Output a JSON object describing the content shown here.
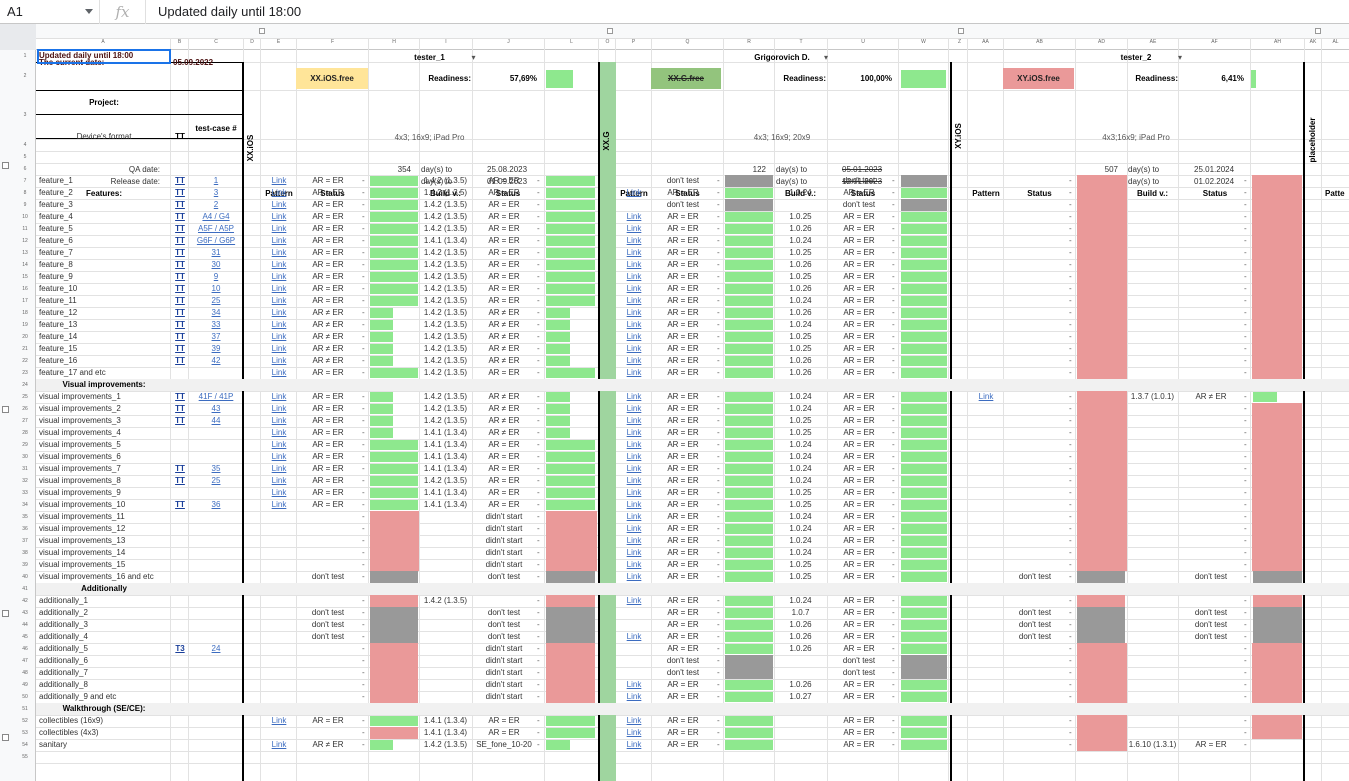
{
  "formula_bar": {
    "cell": "A1",
    "fx": "fx",
    "value": "Updated daily until 18:00"
  },
  "col_headers": [
    "A",
    "B",
    "C",
    "D",
    "E",
    "F",
    "H",
    "I",
    "J",
    "L",
    "O",
    "P",
    "Q",
    "R",
    "T",
    "U",
    "W",
    "Z",
    "AA",
    "AB",
    "AD",
    "AE",
    "AF",
    "AH",
    "AK",
    "AL"
  ],
  "header": {
    "updated": "Updated daily until 18:00",
    "current_date_label": "The current date:",
    "current_date": "05.09.2022",
    "project_label": "Project:",
    "device_label": "Device's format",
    "tt_label": "TT",
    "testcase_label": "test-case #",
    "qa_label": "QA date:",
    "release_label": "Release date:",
    "features_label": "Features:",
    "visual_label": "Visual improvements:",
    "additionally_label": "Additionally",
    "walkthrough_label": "Walkthrough (SE/CE):"
  },
  "vertical_labels": {
    "xx_ios": "XX.iOS",
    "xx_g": "XX.G",
    "xy_ios": "XY.iOS",
    "placeholder": "placeholder"
  },
  "testers": [
    {
      "name": "tester_1",
      "project": "XX.iOS.free",
      "readiness_label": "Readiness:",
      "readiness": "57,69%",
      "formats": "4x3; 16x9; iPad Pro",
      "qa_days": "354",
      "qa_to": "day(s) to",
      "qa_date": "25.08.2023",
      "rel_days": "361",
      "rel_to": "day(s) to",
      "rel_date": "01.09.2023",
      "project_color": "#ffe599"
    },
    {
      "name": "Grigorovich D.",
      "project": "XX.G.free",
      "readiness_label": "Readiness:",
      "readiness": "100,00%",
      "formats": "4x3; 16x9; 20x9",
      "qa_days": "122",
      "qa_to": "day(s) to",
      "qa_date": "05.01.2023",
      "rel_days": "129",
      "rel_to": "day(s) to",
      "rel_date": "12.01.2023",
      "project_color": "#93c47d"
    },
    {
      "name": "tester_2",
      "project": "XY.iOS.free",
      "readiness_label": "Readiness:",
      "readiness": "6,41%",
      "formats": "4x3;16x9; iPad Pro",
      "qa_days": "507",
      "qa_to": "day(s) to",
      "qa_date": "25.01.2024",
      "rel_days": "514",
      "rel_to": "day(s) to",
      "rel_date": "01.02.2024",
      "project_color": "#ea9999"
    }
  ],
  "sub_headers": {
    "pattern": "Pattern",
    "status": "Status",
    "readiness": "Readiness",
    "build": "Build v.:",
    "status2": "Status",
    "readiness2": "Readiness",
    "patte": "Patte"
  },
  "link_text": "Link",
  "rows": [
    {
      "n": "7",
      "name": "feature_1",
      "tt": "TT",
      "tc": "1",
      "t1": [
        "Link",
        "AR = ER",
        "G",
        "1.4.2 (1.3.5)",
        "AR = ER",
        "G"
      ],
      "t2": [
        "",
        "don't test",
        "Y",
        "",
        "don't test",
        "Y"
      ]
    },
    {
      "n": "8",
      "name": "feature_2",
      "tt": "TT",
      "tc": "3",
      "t1": [
        "Link",
        "AR = ER",
        "G",
        "1.4.2 (1.3.5)",
        "AR = ER",
        "G"
      ],
      "t2": [
        "Link",
        "AR = ER",
        "G",
        "1.0.24",
        "AR = ER",
        "G"
      ]
    },
    {
      "n": "9",
      "name": "feature_3",
      "tt": "TT",
      "tc": "2",
      "t1": [
        "Link",
        "AR = ER",
        "G",
        "1.4.2 (1.3.5)",
        "AR = ER",
        "G"
      ],
      "t2": [
        "",
        "don't test",
        "Y",
        "",
        "don't test",
        "Y"
      ]
    },
    {
      "n": "10",
      "name": "feature_4",
      "tt": "TT",
      "tc": "A4 / G4",
      "t1": [
        "Link",
        "AR = ER",
        "G",
        "1.4.2 (1.3.5)",
        "AR = ER",
        "G"
      ],
      "t2": [
        "Link",
        "AR = ER",
        "G",
        "1.0.25",
        "AR = ER",
        "G"
      ]
    },
    {
      "n": "11",
      "name": "feature_5",
      "tt": "TT",
      "tc": "A5F / A5P",
      "t1": [
        "Link",
        "AR = ER",
        "G",
        "1.4.2 (1.3.5)",
        "AR = ER",
        "G"
      ],
      "t2": [
        "Link",
        "AR = ER",
        "G",
        "1.0.26",
        "AR = ER",
        "G"
      ]
    },
    {
      "n": "12",
      "name": "feature_6",
      "tt": "TT",
      "tc": "G6F / G6P",
      "t1": [
        "Link",
        "AR = ER",
        "G",
        "1.4.1 (1.3.4)",
        "AR = ER",
        "G"
      ],
      "t2": [
        "Link",
        "AR = ER",
        "G",
        "1.0.24",
        "AR = ER",
        "G"
      ]
    },
    {
      "n": "13",
      "name": "feature_7",
      "tt": "TT",
      "tc": "31",
      "t1": [
        "Link",
        "AR = ER",
        "G",
        "1.4.2 (1.3.5)",
        "AR = ER",
        "G"
      ],
      "t2": [
        "Link",
        "AR = ER",
        "G",
        "1.0.25",
        "AR = ER",
        "G"
      ]
    },
    {
      "n": "14",
      "name": "feature_8",
      "tt": "TT",
      "tc": "30",
      "t1": [
        "Link",
        "AR = ER",
        "G",
        "1.4.2 (1.3.5)",
        "AR = ER",
        "G"
      ],
      "t2": [
        "Link",
        "AR = ER",
        "G",
        "1.0.26",
        "AR = ER",
        "G"
      ]
    },
    {
      "n": "15",
      "name": "feature_9",
      "tt": "TT",
      "tc": "9",
      "t1": [
        "Link",
        "AR = ER",
        "G",
        "1.4.2 (1.3.5)",
        "AR = ER",
        "G"
      ],
      "t2": [
        "Link",
        "AR = ER",
        "G",
        "1.0.25",
        "AR = ER",
        "G"
      ]
    },
    {
      "n": "16",
      "name": "feature_10",
      "tt": "TT",
      "tc": "10",
      "t1": [
        "Link",
        "AR = ER",
        "G",
        "1.4.2 (1.3.5)",
        "AR = ER",
        "G"
      ],
      "t2": [
        "Link",
        "AR = ER",
        "G",
        "1.0.26",
        "AR = ER",
        "G"
      ]
    },
    {
      "n": "17",
      "name": "feature_11",
      "tt": "TT",
      "tc": "25",
      "t1": [
        "Link",
        "AR = ER",
        "G",
        "1.4.2 (1.3.5)",
        "AR = ER",
        "G"
      ],
      "t2": [
        "Link",
        "AR = ER",
        "G",
        "1.0.24",
        "AR = ER",
        "G"
      ]
    },
    {
      "n": "18",
      "name": "feature_12",
      "tt": "TT",
      "tc": "34",
      "t1": [
        "Link",
        "AR ≠ ER",
        "S",
        "1.4.2 (1.3.5)",
        "AR ≠ ER",
        "S"
      ],
      "t2": [
        "Link",
        "AR = ER",
        "G",
        "1.0.26",
        "AR = ER",
        "G"
      ]
    },
    {
      "n": "19",
      "name": "feature_13",
      "tt": "TT",
      "tc": "33",
      "t1": [
        "Link",
        "AR ≠ ER",
        "S",
        "1.4.2 (1.3.5)",
        "AR ≠ ER",
        "S"
      ],
      "t2": [
        "Link",
        "AR = ER",
        "G",
        "1.0.24",
        "AR = ER",
        "G"
      ]
    },
    {
      "n": "20",
      "name": "feature_14",
      "tt": "TT",
      "tc": "37",
      "t1": [
        "Link",
        "AR ≠ ER",
        "S",
        "1.4.2 (1.3.5)",
        "AR ≠ ER",
        "S"
      ],
      "t2": [
        "Link",
        "AR = ER",
        "G",
        "1.0.25",
        "AR = ER",
        "G"
      ]
    },
    {
      "n": "21",
      "name": "feature_15",
      "tt": "TT",
      "tc": "39",
      "t1": [
        "Link",
        "AR ≠ ER",
        "S",
        "1.4.2 (1.3.5)",
        "AR ≠ ER",
        "S"
      ],
      "t2": [
        "Link",
        "AR = ER",
        "G",
        "1.0.25",
        "AR = ER",
        "G"
      ]
    },
    {
      "n": "22",
      "name": "feature_16",
      "tt": "TT",
      "tc": "42",
      "t1": [
        "Link",
        "AR ≠ ER",
        "S",
        "1.4.2 (1.3.5)",
        "AR ≠ ER",
        "S"
      ],
      "t2": [
        "Link",
        "AR = ER",
        "G",
        "1.0.26",
        "AR = ER",
        "G"
      ]
    },
    {
      "n": "23",
      "name": "feature_17 and etc",
      "tt": "",
      "tc": "",
      "t1": [
        "Link",
        "AR = ER",
        "G",
        "1.4.2 (1.3.5)",
        "AR = ER",
        "G"
      ],
      "t2": [
        "Link",
        "AR = ER",
        "G",
        "1.0.26",
        "AR = ER",
        "G"
      ]
    },
    {
      "n": "24",
      "sec": "visual"
    },
    {
      "n": "25",
      "name": "visual improvements_1",
      "tt": "TT",
      "tc": "41F / 41P",
      "t1": [
        "Link",
        "AR = ER",
        "S",
        "1.4.2 (1.3.5)",
        "AR ≠ ER",
        "S"
      ],
      "t2": [
        "Link",
        "AR = ER",
        "G",
        "1.0.24",
        "AR = ER",
        "G"
      ],
      "t3": [
        "Link",
        "",
        "",
        "1.3.7 (1.0.1)",
        "AR ≠ ER",
        "S"
      ]
    },
    {
      "n": "26",
      "name": "visual improvements_2",
      "tt": "TT",
      "tc": "43",
      "t1": [
        "Link",
        "AR = ER",
        "S",
        "1.4.2 (1.3.5)",
        "AR ≠ ER",
        "S"
      ],
      "t2": [
        "Link",
        "AR = ER",
        "G",
        "1.0.24",
        "AR = ER",
        "G"
      ]
    },
    {
      "n": "27",
      "name": "visual improvements_3",
      "tt": "TT",
      "tc": "44",
      "t1": [
        "Link",
        "AR = ER",
        "S",
        "1.4.2 (1.3.5)",
        "AR ≠ ER",
        "S"
      ],
      "t2": [
        "Link",
        "AR = ER",
        "G",
        "1.0.25",
        "AR = ER",
        "G"
      ]
    },
    {
      "n": "28",
      "name": "visual improvements_4",
      "tt": "",
      "tc": "",
      "t1": [
        "Link",
        "AR = ER",
        "S",
        "1.4.1 (1.3.4)",
        "AR ≠ ER",
        "S"
      ],
      "t2": [
        "Link",
        "AR = ER",
        "G",
        "1.0.25",
        "AR = ER",
        "G"
      ]
    },
    {
      "n": "29",
      "name": "visual improvements_5",
      "tt": "",
      "tc": "",
      "t1": [
        "Link",
        "AR = ER",
        "G",
        "1.4.1 (1.3.4)",
        "AR = ER",
        "G"
      ],
      "t2": [
        "Link",
        "AR = ER",
        "G",
        "1.0.24",
        "AR = ER",
        "G"
      ]
    },
    {
      "n": "30",
      "name": "visual improvements_6",
      "tt": "",
      "tc": "",
      "t1": [
        "Link",
        "AR = ER",
        "G",
        "1.4.1 (1.3.4)",
        "AR = ER",
        "G"
      ],
      "t2": [
        "Link",
        "AR = ER",
        "G",
        "1.0.24",
        "AR = ER",
        "G"
      ]
    },
    {
      "n": "31",
      "name": "visual improvements_7",
      "tt": "TT",
      "tc": "35",
      "t1": [
        "Link",
        "AR = ER",
        "G",
        "1.4.1 (1.3.4)",
        "AR = ER",
        "G"
      ],
      "t2": [
        "Link",
        "AR = ER",
        "G",
        "1.0.24",
        "AR = ER",
        "G"
      ]
    },
    {
      "n": "32",
      "name": "visual improvements_8",
      "tt": "TT",
      "tc": "25",
      "t1": [
        "Link",
        "AR = ER",
        "G",
        "1.4.2 (1.3.5)",
        "AR = ER",
        "G"
      ],
      "t2": [
        "Link",
        "AR = ER",
        "G",
        "1.0.24",
        "AR = ER",
        "G"
      ]
    },
    {
      "n": "33",
      "name": "visual improvements_9",
      "tt": "",
      "tc": "",
      "t1": [
        "Link",
        "AR = ER",
        "G",
        "1.4.1 (1.3.4)",
        "AR = ER",
        "G"
      ],
      "t2": [
        "Link",
        "AR = ER",
        "G",
        "1.0.25",
        "AR = ER",
        "G"
      ]
    },
    {
      "n": "34",
      "name": "visual improvements_10",
      "tt": "TT",
      "tc": "36",
      "t1": [
        "Link",
        "AR = ER",
        "G",
        "1.4.1 (1.3.4)",
        "AR = ER",
        "G"
      ],
      "t2": [
        "Link",
        "AR = ER",
        "G",
        "1.0.25",
        "AR = ER",
        "G"
      ]
    },
    {
      "n": "35",
      "name": "visual improvements_11",
      "tt": "",
      "tc": "",
      "t1": [
        "",
        "",
        "R",
        "",
        "didn't start",
        "R"
      ],
      "t2": [
        "Link",
        "AR = ER",
        "G",
        "1.0.24",
        "AR = ER",
        "G"
      ]
    },
    {
      "n": "36",
      "name": "visual improvements_12",
      "tt": "",
      "tc": "",
      "t1": [
        "",
        "",
        "R",
        "",
        "didn't start",
        "R"
      ],
      "t2": [
        "Link",
        "AR = ER",
        "G",
        "1.0.24",
        "AR = ER",
        "G"
      ]
    },
    {
      "n": "37",
      "name": "visual improvements_13",
      "tt": "",
      "tc": "",
      "t1": [
        "",
        "",
        "R",
        "",
        "didn't start",
        "R"
      ],
      "t2": [
        "Link",
        "AR = ER",
        "G",
        "1.0.24",
        "AR = ER",
        "G"
      ]
    },
    {
      "n": "38",
      "name": "visual improvements_14",
      "tt": "",
      "tc": "",
      "t1": [
        "",
        "",
        "R",
        "",
        "didn't start",
        "R"
      ],
      "t2": [
        "Link",
        "AR = ER",
        "G",
        "1.0.24",
        "AR = ER",
        "G"
      ]
    },
    {
      "n": "39",
      "name": "visual improvements_15",
      "tt": "",
      "tc": "",
      "t1": [
        "",
        "",
        "R",
        "",
        "didn't start",
        "R"
      ],
      "t2": [
        "Link",
        "AR = ER",
        "G",
        "1.0.25",
        "AR = ER",
        "G"
      ]
    },
    {
      "n": "40",
      "name": "visual improvements_16 and etc",
      "tt": "",
      "tc": "",
      "t1": [
        "",
        "don't test",
        "Y",
        "",
        "don't test",
        "Y"
      ],
      "t2": [
        "Link",
        "AR = ER",
        "G",
        "1.0.25",
        "AR = ER",
        "G"
      ],
      "t3": [
        "",
        "don't test",
        "Y",
        "",
        "don't test",
        "Y"
      ]
    },
    {
      "n": "41",
      "sec": "additionally"
    },
    {
      "n": "42",
      "name": "additionally_1",
      "tt": "",
      "tc": "",
      "t1": [
        "",
        "",
        "R",
        "1.4.2 (1.3.5)",
        "",
        "R"
      ],
      "t2": [
        "Link",
        "AR = ER",
        "G",
        "1.0.24",
        "AR = ER",
        "G"
      ],
      "t3": [
        "",
        "",
        "R",
        "",
        "",
        "R"
      ]
    },
    {
      "n": "43",
      "name": "additionally_2",
      "tt": "",
      "tc": "",
      "t1": [
        "",
        "don't test",
        "Y",
        "",
        "don't test",
        "Y"
      ],
      "t2": [
        "",
        "AR = ER",
        "G",
        "1.0.7",
        "AR = ER",
        "G"
      ],
      "t3": [
        "",
        "don't test",
        "Y",
        "",
        "don't test",
        "Y"
      ]
    },
    {
      "n": "44",
      "name": "additionally_3",
      "tt": "",
      "tc": "",
      "t1": [
        "",
        "don't test",
        "Y",
        "",
        "don't test",
        "Y"
      ],
      "t2": [
        "",
        "AR = ER",
        "G",
        "1.0.26",
        "AR = ER",
        "G"
      ],
      "t3": [
        "",
        "don't test",
        "Y",
        "",
        "don't test",
        "Y"
      ]
    },
    {
      "n": "45",
      "name": "additionally_4",
      "tt": "",
      "tc": "",
      "t1": [
        "",
        "don't test",
        "Y",
        "",
        "don't test",
        "Y"
      ],
      "t2": [
        "Link",
        "AR = ER",
        "G",
        "1.0.26",
        "AR = ER",
        "G"
      ],
      "t3": [
        "",
        "don't test",
        "Y",
        "",
        "don't test",
        "Y"
      ]
    },
    {
      "n": "46",
      "name": "additionally_5",
      "tt": "T3",
      "tc": "24",
      "t1": [
        "",
        "",
        "R",
        "",
        "didn't start",
        "R"
      ],
      "t2": [
        "",
        "AR = ER",
        "G",
        "1.0.26",
        "AR = ER",
        "G"
      ],
      "t3": [
        "",
        "",
        "R",
        "",
        "",
        "R"
      ]
    },
    {
      "n": "47",
      "name": "additionally_6",
      "tt": "",
      "tc": "",
      "t1": [
        "",
        "",
        "R",
        "",
        "didn't start",
        "R"
      ],
      "t2": [
        "",
        "don't test",
        "Y",
        "",
        "don't test",
        "Y"
      ]
    },
    {
      "n": "48",
      "name": "additionally_7",
      "tt": "",
      "tc": "",
      "t1": [
        "",
        "",
        "R",
        "",
        "didn't start",
        "R"
      ],
      "t2": [
        "",
        "don't test",
        "Y",
        "",
        "don't test",
        "Y"
      ]
    },
    {
      "n": "49",
      "name": "additionally_8",
      "tt": "",
      "tc": "",
      "t1": [
        "",
        "",
        "R",
        "",
        "didn't start",
        "R"
      ],
      "t2": [
        "Link",
        "AR = ER",
        "G",
        "1.0.26",
        "AR = ER",
        "G"
      ]
    },
    {
      "n": "50",
      "name": "additionally_9 and etc",
      "tt": "",
      "tc": "",
      "t1": [
        "",
        "",
        "R",
        "",
        "didn't start",
        "R"
      ],
      "t2": [
        "Link",
        "AR = ER",
        "G",
        "1.0.27",
        "AR = ER",
        "G"
      ]
    },
    {
      "n": "51",
      "sec": "walk"
    },
    {
      "n": "52",
      "name": "collectibles (16x9)",
      "tt": "",
      "tc": "",
      "t1": [
        "Link",
        "AR = ER",
        "G",
        "1.4.1 (1.3.4)",
        "AR = ER",
        "G"
      ],
      "t2": [
        "Link",
        "AR = ER",
        "G",
        "",
        "AR = ER",
        "G"
      ],
      "t3": [
        "",
        "",
        "R",
        "",
        "",
        "R"
      ]
    },
    {
      "n": "53",
      "name": "collectibles (4x3)",
      "tt": "",
      "tc": "",
      "t1": [
        "",
        "",
        "R",
        "1.4.1 (1.3.4)",
        "AR = ER",
        "G"
      ],
      "t2": [
        "Link",
        "AR = ER",
        "G",
        "",
        "AR = ER",
        "G"
      ],
      "t3": [
        "",
        "",
        "R",
        "",
        "",
        "R"
      ]
    },
    {
      "n": "54",
      "name": "sanitary",
      "tt": "",
      "tc": "",
      "t1": [
        "Link",
        "AR ≠ ER",
        "S",
        "1.4.2 (1.3.5)",
        "SE_fone_10-20",
        "S"
      ],
      "t2": [
        "Link",
        "AR = ER",
        "G",
        "",
        "AR = ER",
        "G"
      ],
      "t3": [
        "",
        "",
        "R",
        "1.6.10 (1.3.1)",
        "AR = ER",
        "G"
      ]
    }
  ],
  "colors": {
    "green": "#8ee88e",
    "red": "#ea9999",
    "gray": "#999999",
    "grid": "#e2e2e2",
    "header_bg": "#f8f9fa"
  }
}
